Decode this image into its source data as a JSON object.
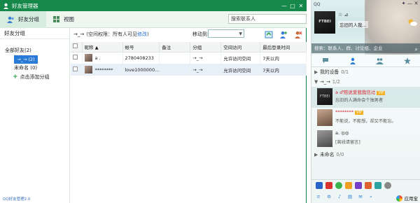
{
  "friend_manager": {
    "title": "好友管理器",
    "controls": {
      "minimize": "—",
      "maximize": "□",
      "close": "✕"
    },
    "toolbar": {
      "tab_groups": "好友分组",
      "tab_view": "视图"
    },
    "search_placeholder": "搜索联系人",
    "left": {
      "header": "好友分组",
      "all_friends": "全部好友(2)",
      "selected_group": "→_→ (2)",
      "unnamed": "未命名 (0)",
      "add_group": "点击添加分组",
      "footer": "QQ好友管理2.0"
    },
    "main": {
      "current_group": "→_→",
      "permission_text": "(空间权限：所有人可见",
      "permission_link": "修改",
      "permission_close": ")",
      "move_to_label": "移动到:",
      "columns": [
        "昵称",
        "帐号",
        "备注",
        "分组",
        "空间访问",
        "最后登录时间"
      ],
      "rows": [
        {
          "nickname": "a .",
          "account": "2780408233",
          "remark": "",
          "group": "→_→",
          "space": "允许访问空间",
          "last_login": "7天以内"
        },
        {
          "nickname": "********",
          "account": "love1000000...",
          "remark": "",
          "group": "→_→",
          "space": "允许访问空间",
          "last_login": "7天以内"
        }
      ]
    }
  },
  "qq_panel": {
    "logo_text": "QQ",
    "controls": {
      "skin": "✦",
      "minimize": "—",
      "close": "✕"
    },
    "profile": {
      "avatar_text": "FTBEI",
      "name": "☆ ⊿",
      "signature": "忘旧的人我..."
    },
    "search_placeholder": "搜索：联系人、群、讨论组、企业",
    "groups": [
      {
        "arrow": "▶",
        "name": "我的设备",
        "count": "0/1"
      },
      {
        "arrow": "▼",
        "name": "→_→",
        "count": "1/2"
      },
      {
        "arrow": "▶",
        "name": "未命名",
        "count": "0/0"
      }
    ],
    "buddies": [
      {
        "avatar_text": "FTBEI",
        "name": "a ♂赔说爱我我信过",
        "badge": "VIP",
        "status": "忘旧的人满命会个独男者"
      },
      {
        "avatar_text": "",
        "name": "********",
        "badge": "VIP",
        "status": "不能说，不能想，却又不能忘。"
      },
      {
        "avatar_text": "",
        "name": "a.",
        "badge": "◎◎",
        "status": "[离线请留言]"
      }
    ],
    "bottom": {
      "app_store": "应用宝"
    }
  }
}
